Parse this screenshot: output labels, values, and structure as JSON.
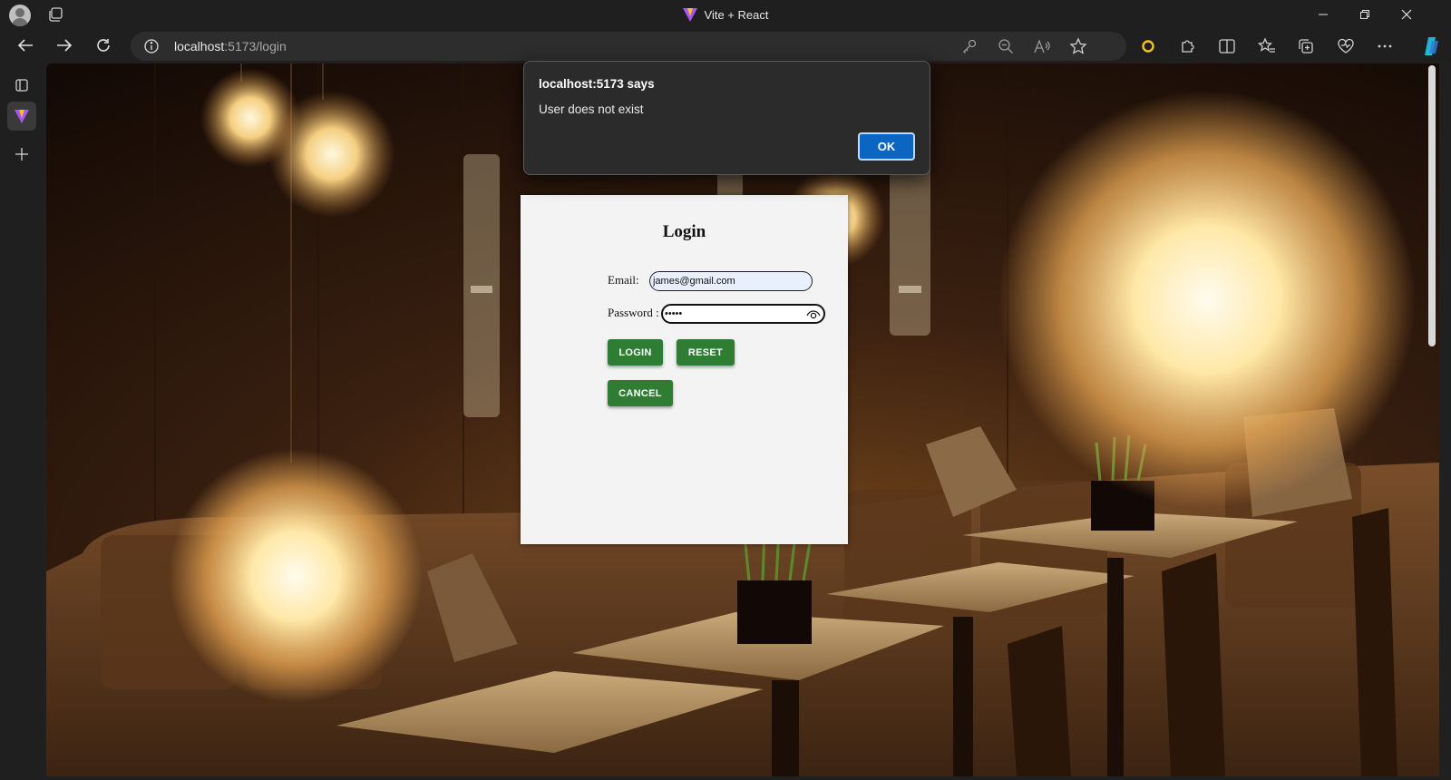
{
  "window": {
    "title": "Vite + React",
    "controls": [
      "minimize-icon",
      "restore-icon",
      "close-icon"
    ]
  },
  "toolbar": {
    "url_host": "localhost",
    "url_path": ":5173/login",
    "icons": [
      "back-icon",
      "forward-icon",
      "refresh-icon",
      "site-info-icon",
      "key-icon",
      "zoom-out-icon",
      "read-aloud-icon",
      "favorite-star-icon",
      "extension-circle-icon",
      "extensions-icon",
      "split-screen-icon",
      "favorites-icon",
      "collections-icon",
      "browser-essentials-icon",
      "more-icon",
      "copilot-icon"
    ]
  },
  "sidebar": {
    "icons": [
      "tab-actions-icon",
      "vite-tab-icon",
      "new-tab-plus-icon"
    ]
  },
  "login": {
    "title": "Login",
    "email_label": "Email:",
    "email_value": "james@gmail.com",
    "password_label": "Password :",
    "password_value": "•••••",
    "login_button": "LOGIN",
    "reset_button": "RESET",
    "cancel_button": "CANCEL",
    "button_color": "#2e7d32"
  },
  "alert": {
    "origin": "localhost:5173 says",
    "message": "User does not exist",
    "ok_button": "OK",
    "ok_color": "#0b66c3"
  }
}
